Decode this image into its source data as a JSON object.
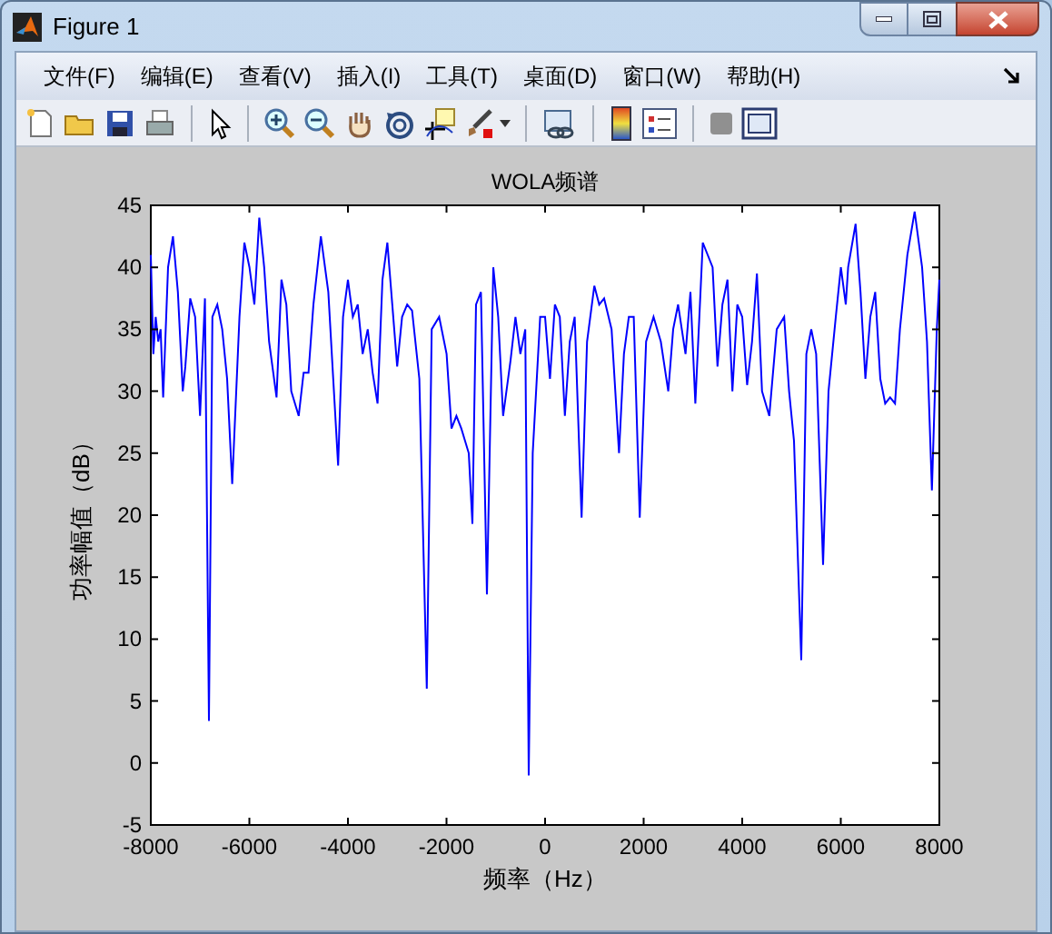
{
  "window": {
    "title": "Figure 1"
  },
  "menu": [
    {
      "label": "文件(F)"
    },
    {
      "label": "编辑(E)"
    },
    {
      "label": "查看(V)"
    },
    {
      "label": "插入(I)"
    },
    {
      "label": "工具(T)"
    },
    {
      "label": "桌面(D)"
    },
    {
      "label": "窗口(W)"
    },
    {
      "label": "帮助(H)"
    }
  ],
  "figure": {
    "chart_data": {
      "type": "line",
      "title": "WOLA频谱",
      "xlabel": "频率（Hz）",
      "ylabel": "功率幅值（dB）",
      "x": [
        -8000,
        -7950,
        -7900,
        -7850,
        -7800,
        -7750,
        -7650,
        -7550,
        -7450,
        -7350,
        -7300,
        -7200,
        -7100,
        -7000,
        -6900,
        -6820,
        -6750,
        -6650,
        -6550,
        -6450,
        -6350,
        -6200,
        -6100,
        -6000,
        -5900,
        -5800,
        -5700,
        -5600,
        -5450,
        -5350,
        -5250,
        -5150,
        -5000,
        -4900,
        -4800,
        -4700,
        -4550,
        -4400,
        -4300,
        -4200,
        -4100,
        -4000,
        -3900,
        -3800,
        -3700,
        -3600,
        -3500,
        -3400,
        -3300,
        -3200,
        -3100,
        -3000,
        -2900,
        -2800,
        -2700,
        -2550,
        -2400,
        -2300,
        -2150,
        -2000,
        -1900,
        -1800,
        -1700,
        -1550,
        -1475,
        -1400,
        -1300,
        -1180,
        -1050,
        -950,
        -850,
        -700,
        -600,
        -500,
        -400,
        -330,
        -250,
        -100,
        0,
        100,
        200,
        300,
        400,
        500,
        600,
        740,
        850,
        1000,
        1100,
        1200,
        1350,
        1500,
        1600,
        1700,
        1800,
        1920,
        2050,
        2200,
        2350,
        2500,
        2600,
        2700,
        2850,
        2950,
        3050,
        3200,
        3400,
        3500,
        3600,
        3700,
        3800,
        3900,
        4000,
        4100,
        4200,
        4300,
        4400,
        4550,
        4700,
        4850,
        4950,
        5050,
        5200,
        5300,
        5400,
        5500,
        5640,
        5750,
        5900,
        6000,
        6100,
        6150,
        6300,
        6400,
        6500,
        6600,
        6700,
        6800,
        6900,
        7000,
        7100,
        7200,
        7350,
        7500,
        7650,
        7750,
        7850,
        7950,
        8000
      ],
      "series": [
        {
          "color": "#0000ff",
          "values": [
            41,
            33,
            36,
            34,
            35,
            29.5,
            40,
            42.5,
            38,
            30,
            32,
            37.5,
            36,
            28,
            37.5,
            3.4,
            36,
            37,
            35,
            31,
            22.5,
            36,
            42,
            40,
            37,
            44,
            40,
            34,
            29.5,
            39,
            37,
            30,
            28,
            31.5,
            31.5,
            37,
            42.5,
            38,
            31,
            24,
            36,
            39,
            36,
            37,
            33,
            35,
            31.5,
            29,
            39,
            42,
            37,
            32,
            36,
            37,
            36.5,
            31,
            6,
            35,
            36,
            33,
            27,
            28,
            27,
            25,
            19.3,
            37,
            38,
            13.6,
            40,
            36,
            28,
            32.5,
            36,
            33,
            35,
            -1,
            25,
            36,
            36,
            31,
            37,
            36,
            28,
            34,
            36,
            19.8,
            34,
            38.5,
            37,
            37.5,
            35,
            25,
            33,
            36,
            36,
            19.8,
            34,
            36,
            34,
            30,
            35,
            37,
            33,
            38,
            29,
            42,
            40,
            32,
            37,
            39,
            30,
            37,
            36,
            30.5,
            34,
            39.5,
            30,
            28,
            35,
            36,
            30,
            26,
            8.3,
            33,
            35,
            33,
            16,
            30,
            36,
            40,
            37,
            40,
            43.5,
            38,
            31,
            36,
            38,
            31,
            29,
            29.5,
            29,
            35,
            41,
            44.5,
            40,
            34,
            22,
            35,
            39
          ]
        }
      ],
      "xlim": [
        -8000,
        8000
      ],
      "ylim": [
        -5,
        45
      ],
      "xticks": [
        -8000,
        -6000,
        -4000,
        -2000,
        0,
        2000,
        4000,
        6000,
        8000
      ],
      "yticks": [
        -5,
        0,
        5,
        10,
        15,
        20,
        25,
        30,
        35,
        40,
        45
      ]
    }
  }
}
